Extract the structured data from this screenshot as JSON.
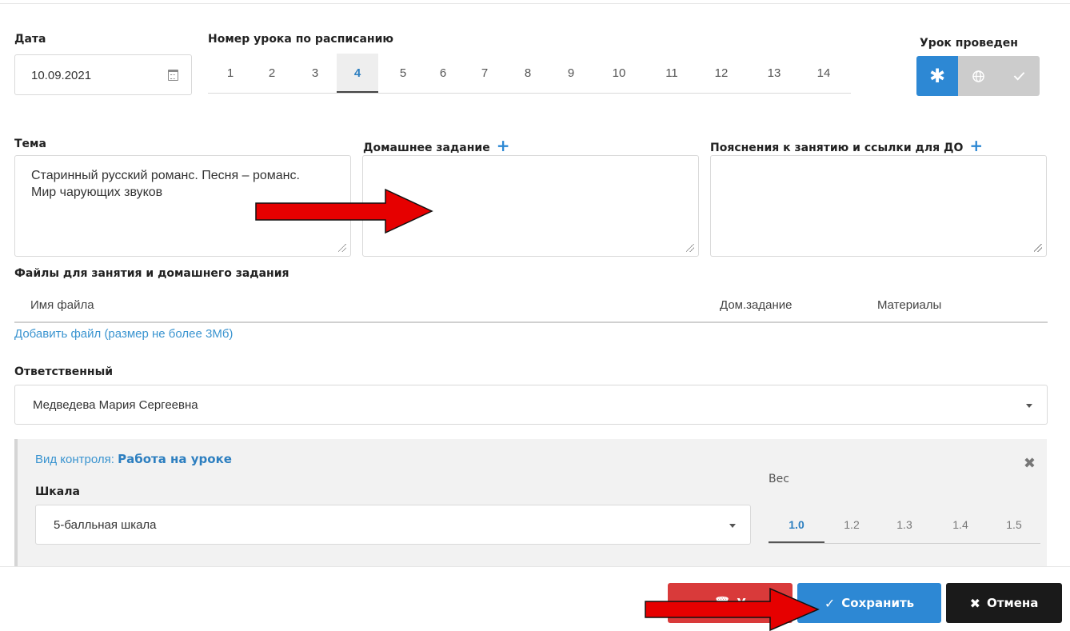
{
  "date": {
    "label": "Дата",
    "value": "10.09.2021"
  },
  "lesson": {
    "label": "Номер урока по расписанию",
    "numbers": [
      "1",
      "2",
      "3",
      "4",
      "5",
      "6",
      "7",
      "8",
      "9",
      "10",
      "11",
      "12",
      "13",
      "14"
    ],
    "active": "4"
  },
  "status": {
    "label": "Урок проведен",
    "icons": [
      "asterisk-icon",
      "globe-icon",
      "check-icon"
    ]
  },
  "topic": {
    "label": "Тема",
    "value": "Старинный русский романс. Песня – романс. Мир чарующих звуков"
  },
  "homework": {
    "label": "Домашнее задание",
    "add": "+"
  },
  "notes": {
    "label": "Пояснения к занятию и ссылки для ДО",
    "add": "+"
  },
  "files": {
    "label": "Файлы для занятия и домашнего задания",
    "col_name": "Имя файла",
    "col_homework": "Дом.задание",
    "col_materials": "Материалы",
    "add_link": "Добавить файл (размер не более 3Мб)"
  },
  "responsible": {
    "label": "Ответственный",
    "value": "Медведева Мария Сергеевна"
  },
  "control": {
    "prefix": "Вид контроля:",
    "type": "Работа на уроке",
    "scale_label": "Шкала",
    "scale_value": "5-балльная шкала",
    "weight_label": "Вес",
    "weights": [
      "1.0",
      "1.2",
      "1.3",
      "1.4",
      "1.5"
    ],
    "active_weight": "1.0"
  },
  "buttons": {
    "delete": "У",
    "save": "Сохранить",
    "cancel": "Отмена"
  },
  "colors": {
    "accent": "#2d88d4",
    "danger": "#d93a3a",
    "dark": "#1a1a1a"
  }
}
